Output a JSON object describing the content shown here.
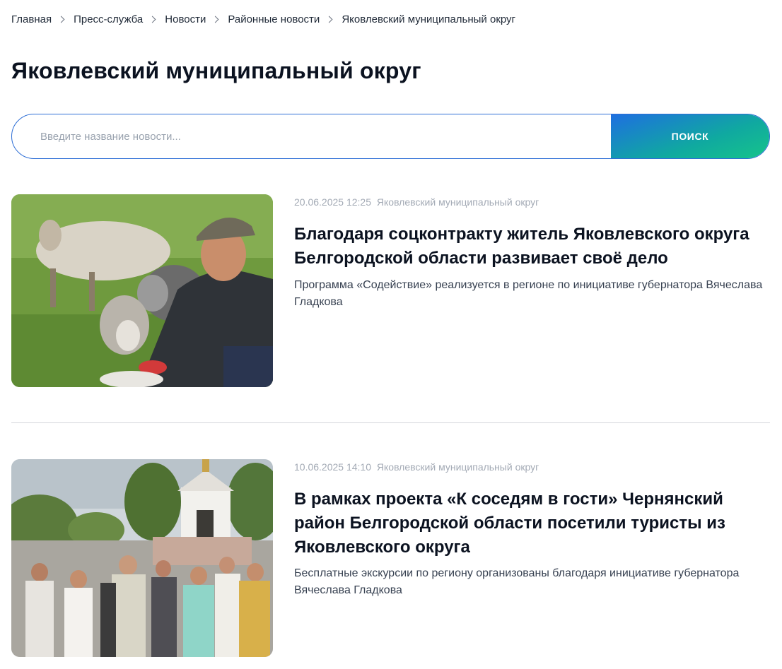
{
  "breadcrumb": {
    "items": [
      {
        "label": "Главная"
      },
      {
        "label": "Пресс-служба"
      },
      {
        "label": "Новости"
      },
      {
        "label": "Районные новости"
      },
      {
        "label": "Яковлевский муниципальный округ"
      }
    ]
  },
  "page": {
    "title": "Яковлевский муниципальный округ"
  },
  "search": {
    "placeholder": "Введите название новости...",
    "value": "",
    "button_label": "ПОИСК"
  },
  "news": [
    {
      "date": "20.06.2025 12:25",
      "district": "Яковлевский муниципальный округ",
      "title": "Благодаря соцконтракту житель Яковлевского округа Белгородской области развивает своё дело",
      "lead": "Программа «Содействие» реализуется в регионе по инициативе губернатора Вячеслава Гладкова",
      "image": "man-with-sheep-photo"
    },
    {
      "date": "10.06.2025 14:10",
      "district": "Яковлевский муниципальный округ",
      "title": "В рамках проекта «К соседям в гости» Чернянский район Белгородской области посетили туристы из Яковлевского округа",
      "lead": "Бесплатные экскурсии по региону организованы благодаря инициативе губернатора Вячеслава Гладкова",
      "image": "tourist-group-at-church-photo"
    }
  ],
  "colors": {
    "accent_blue": "#2f6fd6",
    "gradient_start": "#1e6fe0",
    "gradient_end": "#16c48a",
    "meta_gray": "#a3aab5"
  }
}
